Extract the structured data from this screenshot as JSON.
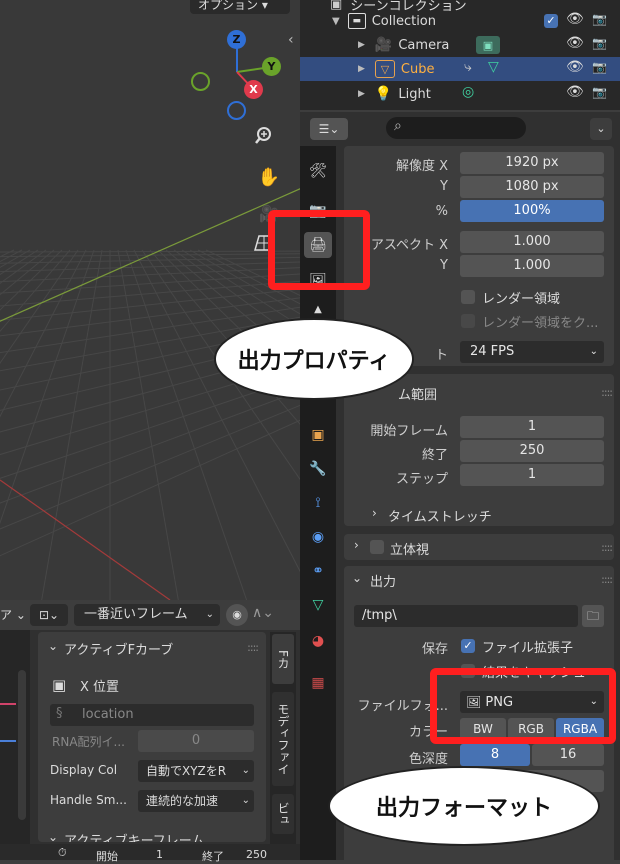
{
  "viewport": {
    "options_label": "オプション ▾",
    "gizmo": {
      "z": "Z",
      "y": "Y",
      "x": "X"
    }
  },
  "outliner": {
    "header_label": "シーンコレクション",
    "rows": [
      {
        "label": "Collection"
      },
      {
        "label": "Camera"
      },
      {
        "label": "Cube"
      },
      {
        "label": "Light"
      }
    ]
  },
  "properties": {
    "search_placeholder": "",
    "resolution_x_label": "解像度 X",
    "resolution_x": "1920 px",
    "resolution_y_label": "Y",
    "resolution_y": "1080 px",
    "percent_label": "%",
    "percent": "100%",
    "aspect_x_label": "アスペクト X",
    "aspect_x": "1.000",
    "aspect_y_label": "Y",
    "aspect_y": "1.000",
    "render_region": "レンダー領域",
    "crop_region": "レンダー領域をク...",
    "framerate_label": "ト",
    "framerate": "24 FPS",
    "frame_range_header": "ム範囲",
    "frame_start_label": "開始フレーム",
    "frame_start": "1",
    "frame_end_label": "終了",
    "frame_end": "250",
    "frame_step_label": "ステップ",
    "frame_step": "1",
    "time_stretch": "タイムストレッチ",
    "stereoscopy": "立体視",
    "output_header": "出力",
    "output_path": "/tmp\\",
    "save_label": "保存",
    "file_ext": "ファイル拡張子",
    "cache_result": "結果をキャッシュ",
    "file_format_label": "ファイルフォ...",
    "file_format": "PNG",
    "color_label": "カラー",
    "color_modes": [
      "BW",
      "RGB",
      "RGBA"
    ],
    "depth_label": "色深度",
    "depth_options": [
      "8",
      "16"
    ]
  },
  "graph": {
    "snap_label": "一番近いフレーム",
    "active_fcurve": "アクティブFカーブ",
    "channel": "X 位置",
    "data_path": "location",
    "rna_label": "RNA配列イ...",
    "rna_value": "0",
    "display_color_label": "Display Col",
    "display_color": "自動でXYZをR",
    "handle_label": "Handle Sm...",
    "handle": "連続的な加速",
    "active_keyframe": "アクティブキーフレーム",
    "vtabs": [
      "Fカ",
      "モディファイ",
      "ビュ"
    ],
    "start_label": "開始",
    "start": "1",
    "end_label": "終了",
    "end": "250"
  },
  "callouts": {
    "output_properties": "出力プロパティ",
    "output_format": "出力フォーマット"
  }
}
